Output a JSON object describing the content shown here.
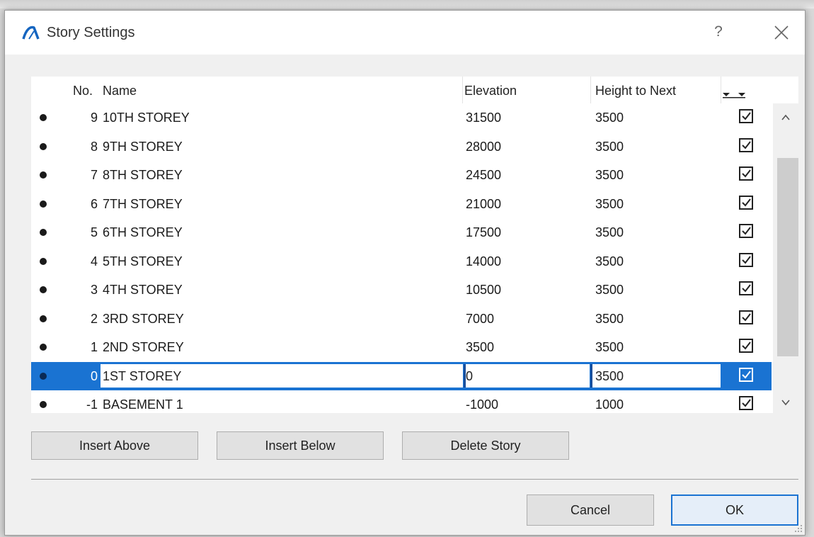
{
  "dialog": {
    "title": "Story Settings",
    "help_label": "?"
  },
  "table": {
    "columns": {
      "no": "No.",
      "name": "Name",
      "elevation": "Elevation",
      "height_to_next": "Height to Next"
    },
    "rows": [
      {
        "no": "9",
        "name": "10TH STOREY",
        "elevation": "31500",
        "height_to_next": "3500",
        "checked": true
      },
      {
        "no": "8",
        "name": "9TH STOREY",
        "elevation": "28000",
        "height_to_next": "3500",
        "checked": true
      },
      {
        "no": "7",
        "name": "8TH STOREY",
        "elevation": "24500",
        "height_to_next": "3500",
        "checked": true
      },
      {
        "no": "6",
        "name": "7TH STOREY",
        "elevation": "21000",
        "height_to_next": "3500",
        "checked": true
      },
      {
        "no": "5",
        "name": "6TH STOREY",
        "elevation": "17500",
        "height_to_next": "3500",
        "checked": true
      },
      {
        "no": "4",
        "name": "5TH STOREY",
        "elevation": "14000",
        "height_to_next": "3500",
        "checked": true
      },
      {
        "no": "3",
        "name": "4TH STOREY",
        "elevation": "10500",
        "height_to_next": "3500",
        "checked": true
      },
      {
        "no": "2",
        "name": "3RD STOREY",
        "elevation": "7000",
        "height_to_next": "3500",
        "checked": true
      },
      {
        "no": "1",
        "name": "2ND STOREY",
        "elevation": "3500",
        "height_to_next": "3500",
        "checked": true
      },
      {
        "no": "0",
        "name": "1ST STOREY",
        "elevation": "0",
        "height_to_next": "3500",
        "checked": true
      },
      {
        "no": "-1",
        "name": "BASEMENT 1",
        "elevation": "-1000",
        "height_to_next": "1000",
        "checked": true
      }
    ],
    "selected_row_index": 9
  },
  "actions": {
    "insert_above": "Insert Above",
    "insert_below": "Insert Below",
    "delete_story": "Delete Story",
    "cancel": "Cancel",
    "ok": "OK"
  },
  "icons": {
    "app": "archicad-icon",
    "close": "close-icon",
    "scroll_up": "chevron-up-icon",
    "scroll_down": "chevron-down-icon",
    "show_toggle": "double-triangle-icon",
    "resize": "resize-grip-icon"
  },
  "colors": {
    "selection": "#1a73d2",
    "dialog_bg": "#f0f0f0",
    "default_button_border": "#1a73d2"
  }
}
